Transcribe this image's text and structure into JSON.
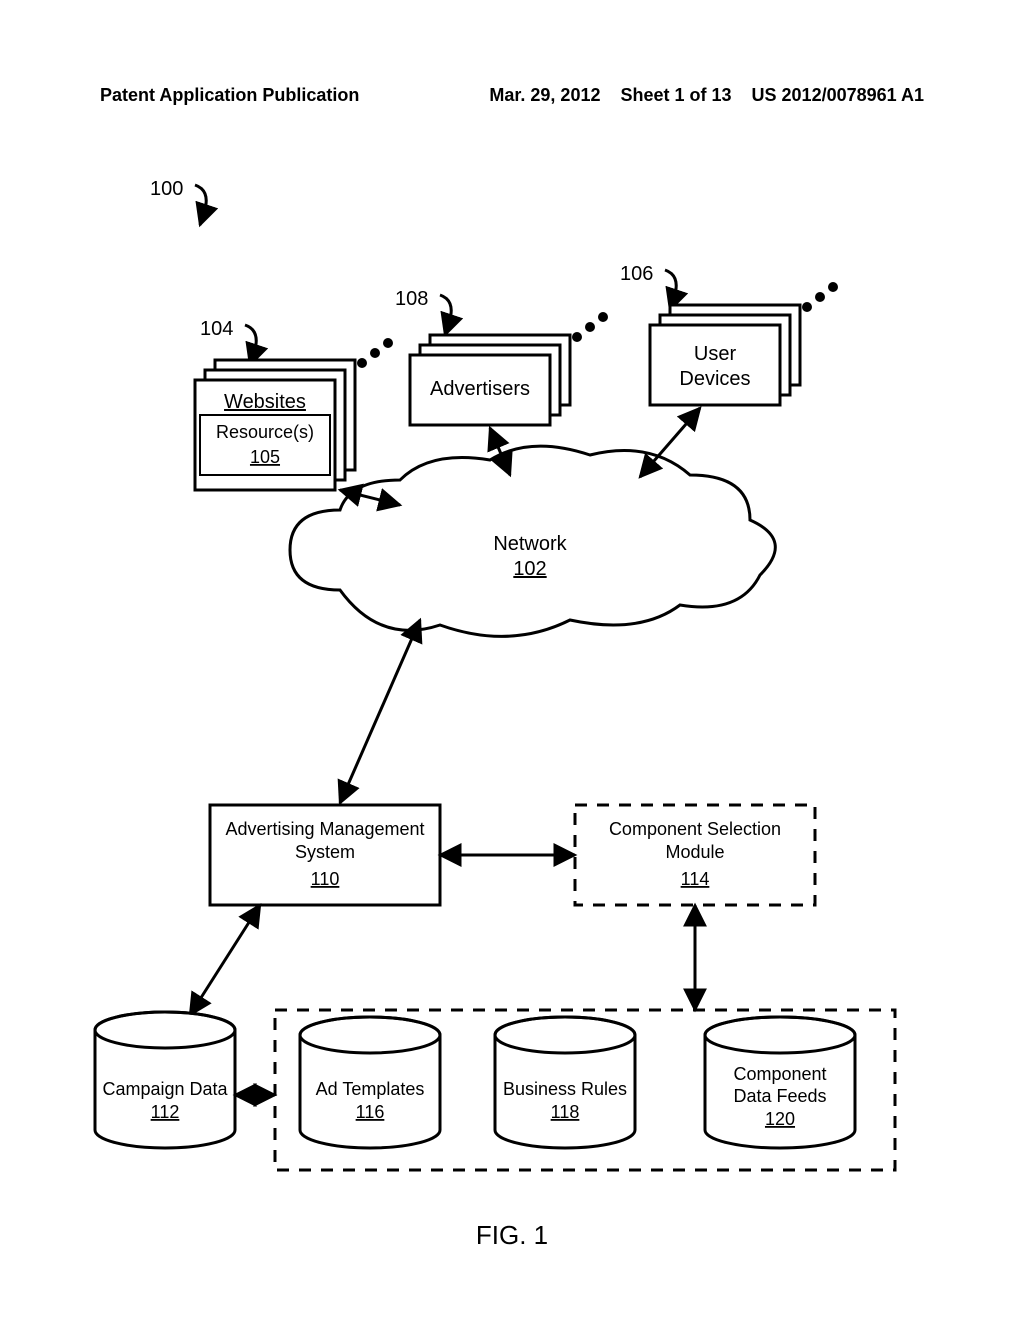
{
  "header": {
    "left": "Patent Application Publication",
    "date": "Mar. 29, 2012",
    "sheet": "Sheet 1 of 13",
    "pubno": "US 2012/0078961 A1"
  },
  "figure_label": "FIG. 1",
  "refs": {
    "r100": "100",
    "r104": "104",
    "r108": "108",
    "r106": "106"
  },
  "nodes": {
    "websites": {
      "title": "Websites",
      "sub": "Resource(s)",
      "num": "105"
    },
    "advertisers": {
      "title": "Advertisers"
    },
    "userdev": {
      "line1": "User",
      "line2": "Devices"
    },
    "network": {
      "title": "Network",
      "num": "102"
    },
    "ams": {
      "line1": "Advertising Management",
      "line2": "System",
      "num": "110"
    },
    "csm": {
      "line1": "Component Selection",
      "line2": "Module",
      "num": "114"
    },
    "campaign": {
      "title": "Campaign Data",
      "num": "112"
    },
    "adtemp": {
      "title": "Ad Templates",
      "num": "116"
    },
    "brules": {
      "title": "Business Rules",
      "num": "118"
    },
    "cdf": {
      "line1": "Component",
      "line2": "Data Feeds",
      "num": "120"
    }
  }
}
